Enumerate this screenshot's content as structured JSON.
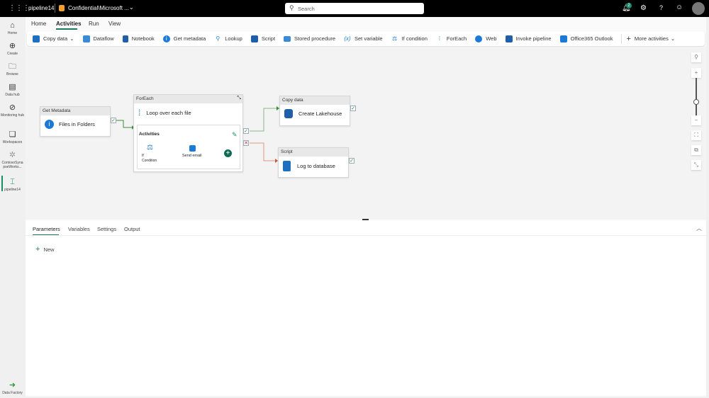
{
  "topbar": {
    "pipeline_name": "pipeline14",
    "sensitivity": "Confidential\\Microsoft ...",
    "search_placeholder": "Search",
    "notification_count": "2"
  },
  "rail": {
    "items": [
      {
        "label": "Home",
        "icon": "home-icon"
      },
      {
        "label": "Create",
        "icon": "plus-circle-icon"
      },
      {
        "label": "Browse",
        "icon": "folder-icon"
      },
      {
        "label": "Data hub",
        "icon": "database-icon"
      },
      {
        "label": "Monitoring hub",
        "icon": "monitor-icon"
      },
      {
        "label": "Workspaces",
        "icon": "workspaces-icon"
      },
      {
        "label": "ContosoSynapseWorks...",
        "icon": "workspace-icon"
      },
      {
        "label": "pipeline14",
        "icon": "pipeline-icon"
      }
    ],
    "footer": "Data Factory"
  },
  "ribbon": {
    "tabs": [
      "Home",
      "Activities",
      "Run",
      "View"
    ],
    "active": "Activities"
  },
  "toolbar": {
    "items": [
      {
        "label": "Copy data",
        "color": "#1f6fc1"
      },
      {
        "label": "Dataflow",
        "color": "#3b8ad8"
      },
      {
        "label": "Notebook",
        "color": "#1f5fa8"
      },
      {
        "label": "Get metadata",
        "color": "#1c7ad6"
      },
      {
        "label": "Lookup",
        "color": "#1c7ad6"
      },
      {
        "label": "Script",
        "color": "#1f5fa8"
      },
      {
        "label": "Stored procedure",
        "color": "#3b8ad8"
      },
      {
        "label": "Set variable",
        "color": "#1c7ad6"
      },
      {
        "label": "If condition",
        "color": "#1c7ad6"
      },
      {
        "label": "ForEach",
        "color": "#1c7ad6"
      },
      {
        "label": "Web",
        "color": "#1c7ad6"
      },
      {
        "label": "Invoke pipeline",
        "color": "#1f5fa8"
      },
      {
        "label": "Office365 Outlook",
        "color": "#1c7ad6"
      }
    ],
    "more": "More activities"
  },
  "canvas": {
    "get_metadata": {
      "type": "Get Metadata",
      "name": "Files in Folders"
    },
    "foreach": {
      "type": "ForEach",
      "name": "Loop over each file",
      "activities_label": "Activities",
      "inner": [
        "If Condition",
        "Send email"
      ]
    },
    "copy": {
      "type": "Copy data",
      "name": "Create Lakehouse"
    },
    "script": {
      "type": "Script",
      "name": "Log to database"
    },
    "colors": {
      "success": "#3c8b3c",
      "failure": "#c8553d"
    }
  },
  "bottom": {
    "tabs": [
      "Parameters",
      "Variables",
      "Settings",
      "Output"
    ],
    "active": "Parameters",
    "new_label": "New"
  }
}
